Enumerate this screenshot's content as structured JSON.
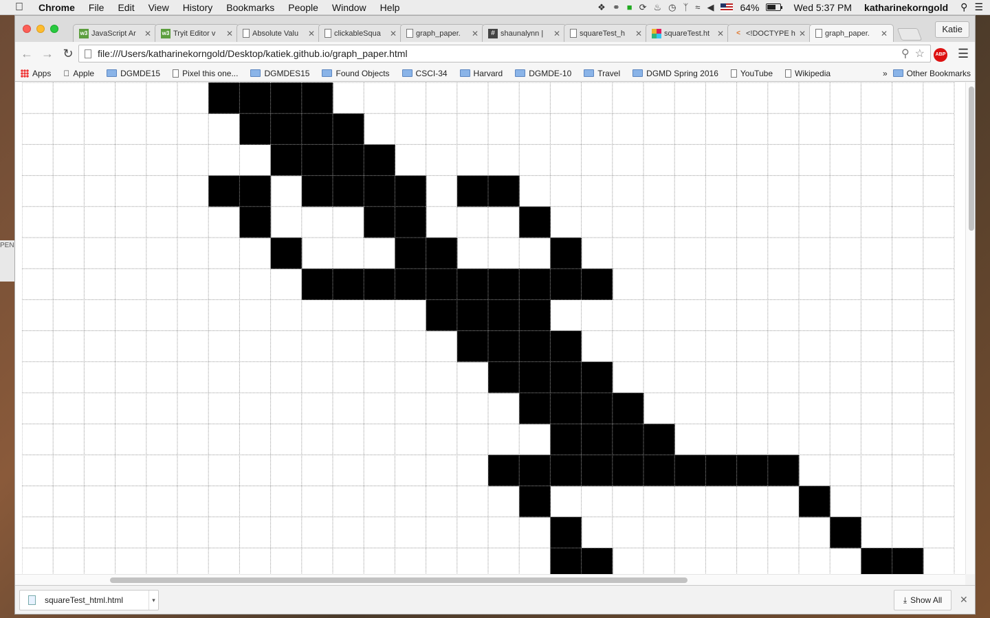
{
  "menubar": {
    "app_name": "Chrome",
    "menus": [
      "File",
      "Edit",
      "View",
      "History",
      "Bookmarks",
      "People",
      "Window",
      "Help"
    ],
    "battery_percent": "64%",
    "battery_level": 0.64,
    "clock": "Wed 5:37 PM",
    "username": "katharinekorngold"
  },
  "tabs": [
    {
      "title": "JavaScript Ar",
      "icon": "w3schools-icon"
    },
    {
      "title": "Tryit Editor v",
      "icon": "w3schools-icon"
    },
    {
      "title": "Absolute Valu",
      "icon": "document-icon"
    },
    {
      "title": "clickableSqua",
      "icon": "document-icon"
    },
    {
      "title": "graph_paper.",
      "icon": "document-icon"
    },
    {
      "title": "shaunalynn |",
      "icon": "hash-icon"
    },
    {
      "title": "squareTest_h",
      "icon": "document-icon"
    },
    {
      "title": "squareTest.ht",
      "icon": "slack-icon"
    },
    {
      "title": "<!DOCTYPE h",
      "icon": "code-icon"
    },
    {
      "title": "graph_paper.",
      "icon": "document-icon",
      "active": true
    }
  ],
  "profile_name": "Katie",
  "address": {
    "url": "file:///Users/katharinekorngold/Desktop/katiek.github.io/graph_paper.html",
    "extension_label": "ABP"
  },
  "bookmarks": [
    {
      "label": "Apps",
      "type": "apps"
    },
    {
      "label": "Apple",
      "type": "apple"
    },
    {
      "label": "DGMDE15",
      "type": "folder"
    },
    {
      "label": "Pixel this one...",
      "type": "page"
    },
    {
      "label": "DGMDES15",
      "type": "folder"
    },
    {
      "label": "Found Objects",
      "type": "folder"
    },
    {
      "label": "CSCI-34",
      "type": "folder"
    },
    {
      "label": "Harvard",
      "type": "folder"
    },
    {
      "label": "DGMDE-10",
      "type": "folder"
    },
    {
      "label": "Travel",
      "type": "folder"
    },
    {
      "label": "DGMD Spring 2016",
      "type": "folder"
    },
    {
      "label": "YouTube",
      "type": "page"
    },
    {
      "label": "Wikipedia",
      "type": "page"
    }
  ],
  "bookmarks_overflow": "»",
  "other_bookmarks": "Other Bookmarks",
  "graph_paper": {
    "columns": 30,
    "rows": 16,
    "filled_cells": [
      [
        0,
        6
      ],
      [
        0,
        7
      ],
      [
        0,
        8
      ],
      [
        0,
        9
      ],
      [
        1,
        7
      ],
      [
        1,
        8
      ],
      [
        1,
        9
      ],
      [
        1,
        10
      ],
      [
        2,
        8
      ],
      [
        2,
        9
      ],
      [
        2,
        10
      ],
      [
        2,
        11
      ],
      [
        3,
        6
      ],
      [
        3,
        7
      ],
      [
        3,
        9
      ],
      [
        3,
        10
      ],
      [
        3,
        11
      ],
      [
        3,
        12
      ],
      [
        3,
        14
      ],
      [
        3,
        15
      ],
      [
        4,
        7
      ],
      [
        4,
        11
      ],
      [
        4,
        12
      ],
      [
        4,
        16
      ],
      [
        5,
        8
      ],
      [
        5,
        12
      ],
      [
        5,
        13
      ],
      [
        5,
        17
      ],
      [
        6,
        9
      ],
      [
        6,
        10
      ],
      [
        6,
        11
      ],
      [
        6,
        12
      ],
      [
        6,
        13
      ],
      [
        6,
        14
      ],
      [
        6,
        15
      ],
      [
        6,
        16
      ],
      [
        6,
        17
      ],
      [
        6,
        18
      ],
      [
        7,
        13
      ],
      [
        7,
        14
      ],
      [
        7,
        15
      ],
      [
        7,
        16
      ],
      [
        8,
        14
      ],
      [
        8,
        15
      ],
      [
        8,
        16
      ],
      [
        8,
        17
      ],
      [
        9,
        15
      ],
      [
        9,
        16
      ],
      [
        9,
        17
      ],
      [
        9,
        18
      ],
      [
        10,
        16
      ],
      [
        10,
        17
      ],
      [
        10,
        18
      ],
      [
        10,
        19
      ],
      [
        11,
        17
      ],
      [
        11,
        18
      ],
      [
        11,
        19
      ],
      [
        11,
        20
      ],
      [
        12,
        15
      ],
      [
        12,
        16
      ],
      [
        12,
        17
      ],
      [
        12,
        18
      ],
      [
        12,
        19
      ],
      [
        12,
        20
      ],
      [
        12,
        21
      ],
      [
        12,
        22
      ],
      [
        12,
        23
      ],
      [
        12,
        24
      ],
      [
        13,
        16
      ],
      [
        13,
        25
      ],
      [
        14,
        17
      ],
      [
        14,
        26
      ],
      [
        15,
        17
      ],
      [
        15,
        18
      ],
      [
        15,
        27
      ],
      [
        15,
        28
      ]
    ],
    "fill_color": "#000000",
    "line_color": "#9a9a9a"
  },
  "downloads": {
    "file_name": "squareTest_html.html",
    "show_all_label": "Show All"
  },
  "background_window_text": "PEN"
}
